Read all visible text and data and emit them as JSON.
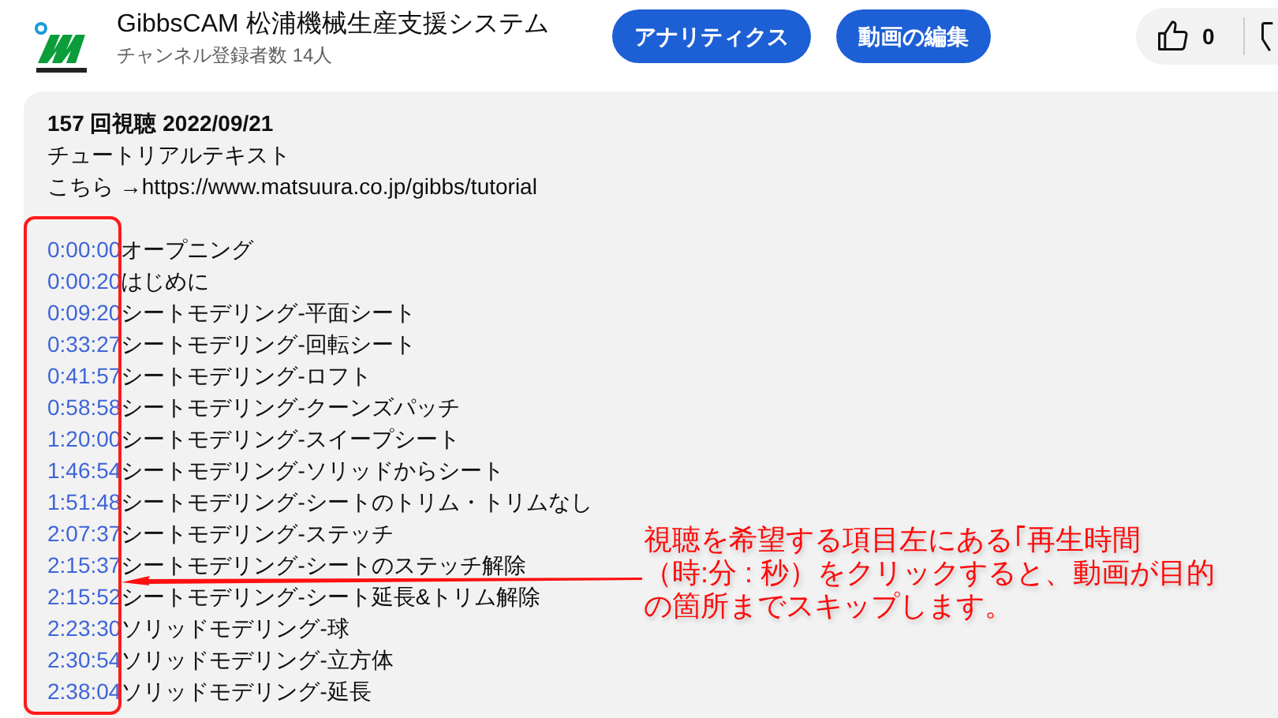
{
  "channel": {
    "name": "GibbsCAM 松浦機械生産支援システム",
    "subscribers": "チャンネル登録者数 14人"
  },
  "buttons": [
    "アナリティクス",
    "動画の編集"
  ],
  "likes": {
    "count": "0"
  },
  "description": {
    "meta": "157 回視聴  2022/09/21",
    "lines": [
      "チュートリアルテキスト",
      "こちら →https://www.matsuura.co.jp/gibbs/tutorial"
    ],
    "chapters": [
      {
        "time": "0:00:00",
        "title": "オープニング"
      },
      {
        "time": "0:00:20",
        "title": "はじめに"
      },
      {
        "time": "0:09:20",
        "title": "シートモデリング-平面シート"
      },
      {
        "time": "0:33:27",
        "title": "シートモデリング-回転シート"
      },
      {
        "time": "0:41:57",
        "title": "シートモデリング-ロフト"
      },
      {
        "time": "0:58:58",
        "title": "シートモデリング-クーンズパッチ"
      },
      {
        "time": "1:20:00",
        "title": "シートモデリング-スイープシート"
      },
      {
        "time": "1:46:54",
        "title": "シートモデリング-ソリッドからシート"
      },
      {
        "time": "1:51:48",
        "title": "シートモデリング-シートのトリム・トリムなし"
      },
      {
        "time": "2:07:37",
        "title": "シートモデリング-ステッチ"
      },
      {
        "time": "2:15:37",
        "title": "シートモデリング-シートのステッチ解除"
      },
      {
        "time": "2:15:52",
        "title": "シートモデリング-シート延長&トリム解除"
      },
      {
        "time": "2:23:30",
        "title": "ソリッドモデリング-球"
      },
      {
        "time": "2:30:54",
        "title": "ソリッドモデリング-立方体"
      },
      {
        "time": "2:38:04",
        "title": "ソリッドモデリング-延長"
      }
    ]
  },
  "annotation": {
    "lines": [
      "視聴を希望する項目左にある｢再生時間",
      "（時:分 : 秒）をクリックすると、動画が目的",
      "の箇所までスキップします。"
    ]
  }
}
